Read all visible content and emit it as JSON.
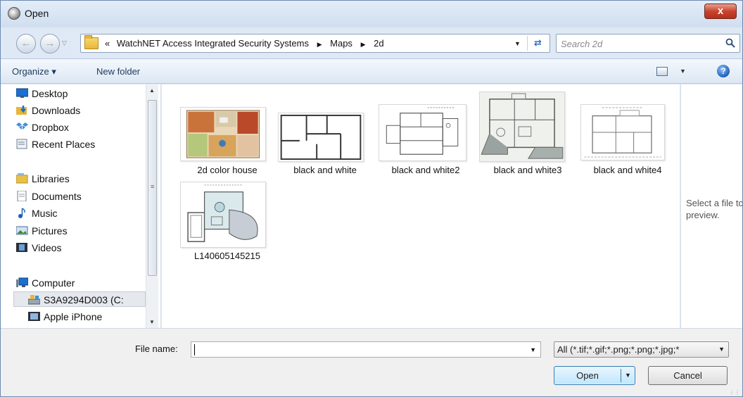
{
  "window": {
    "title": "Open",
    "close_label": "x"
  },
  "address": {
    "overflow": "«",
    "crumbs": [
      "WatchNET Access Integrated Security Systems",
      "Maps",
      "2d"
    ]
  },
  "search": {
    "placeholder": "Search 2d"
  },
  "toolbar": {
    "organize": "Organize ▾",
    "new_folder": "New folder",
    "help": "?"
  },
  "navigation": {
    "favorites": [
      "Desktop",
      "Downloads",
      "Dropbox",
      "Recent Places"
    ],
    "libraries_label": "Libraries",
    "libraries": [
      "Documents",
      "Music",
      "Pictures",
      "Videos"
    ],
    "computer_label": "Computer",
    "computer": [
      "S3A9294D003 (C:",
      "Apple iPhone"
    ]
  },
  "files": [
    {
      "label": "2d color house",
      "icon": "color-house-thumbnail"
    },
    {
      "label": "black and white",
      "icon": "floorplan-thumbnail"
    },
    {
      "label": "black and white2",
      "icon": "floorplan-thumbnail"
    },
    {
      "label": "black and white3",
      "icon": "floorplan-thumbnail"
    },
    {
      "label": "black and white4",
      "icon": "floorplan-thumbnail"
    },
    {
      "label": "L140605145215",
      "icon": "floorplan-thumbnail"
    }
  ],
  "preview": {
    "text": "Select a file to preview."
  },
  "footer": {
    "file_name_label": "File name:",
    "file_name_value": "",
    "filter": "All (*.tif;*.gif;*.png;*.png;*.jpg;*",
    "open_label": "Open",
    "cancel_label": "Cancel"
  },
  "colors": {
    "accent": "#2d6fbe",
    "titlebar": "#dfe9f5",
    "close": "#c9442d"
  }
}
